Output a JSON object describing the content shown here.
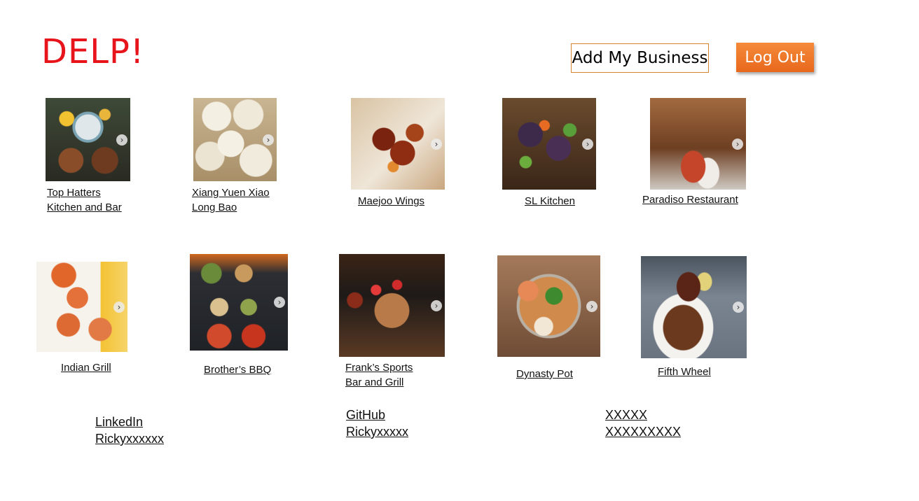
{
  "header": {
    "logo": "DELP!",
    "add_business_label": "Add My Business",
    "logout_label": "Log Out",
    "accent_color": "#e8141b",
    "button_color": "#ee7a2c"
  },
  "restaurants": [
    {
      "name": "Top Hatters\nKitchen and Bar"
    },
    {
      "name": "Xiang Yuen Xiao\nLong Bao"
    },
    {
      "name": "Maejoo Wings"
    },
    {
      "name": "SL Kitchen"
    },
    {
      "name": "Paradiso Restaurant"
    },
    {
      "name": "Indian Grill"
    },
    {
      "name": "Brother’s BBQ"
    },
    {
      "name": "Frank’s Sports\nBar and Grill"
    },
    {
      "name": "Dynasty Pot"
    },
    {
      "name": "Fifth Wheel"
    }
  ],
  "carousel_icon": "chevron-right-icon",
  "footer": {
    "linkedin_label": "LinkedIn",
    "linkedin_value": "Rickyxxxxxx",
    "github_label": "GitHub",
    "github_value": "Rickyxxxxx",
    "other_label": "XXXXX",
    "other_value": "XXXXXXXXX"
  }
}
